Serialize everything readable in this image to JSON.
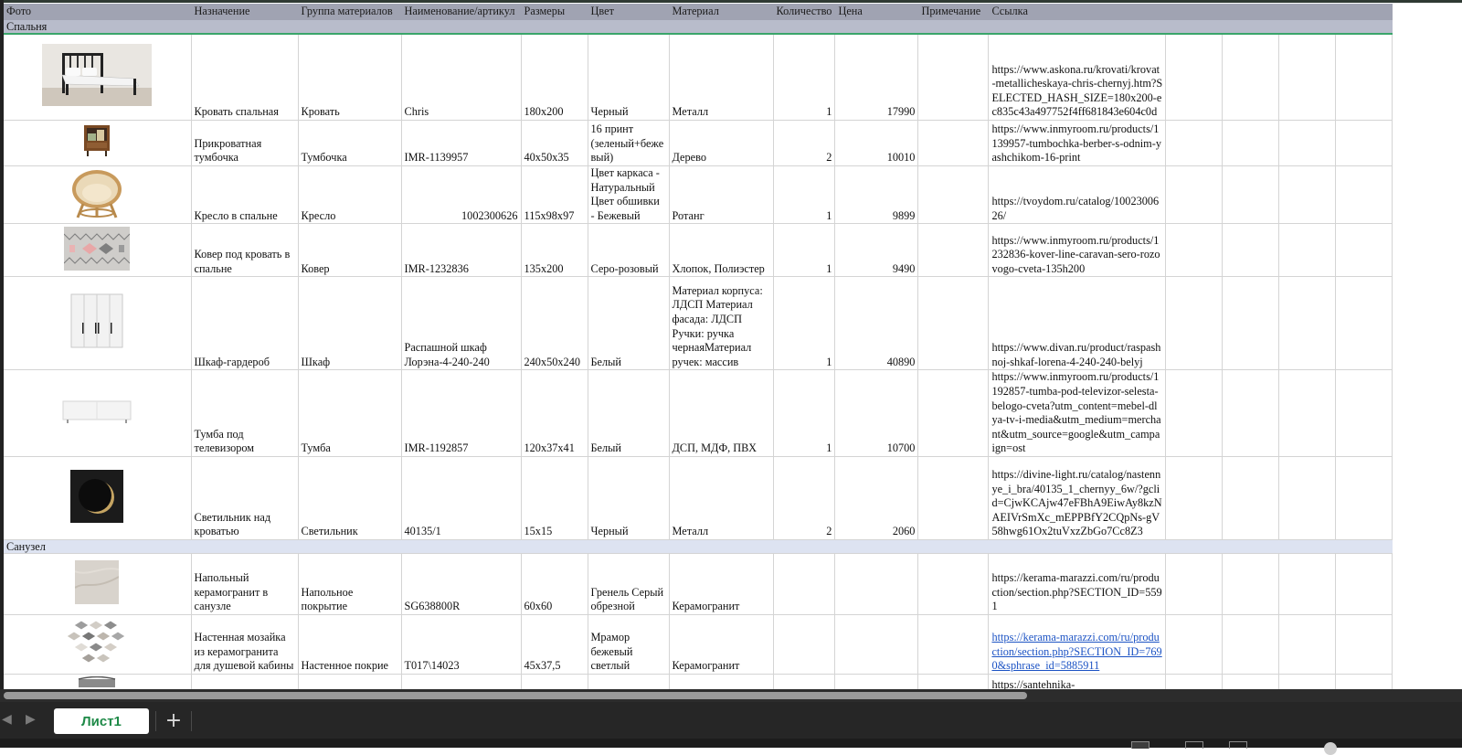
{
  "headers": [
    "Фото",
    "Назначение",
    "Группа материалов",
    "Наименование/артикул",
    "Размеры",
    "Цвет",
    "Материал",
    "Количество",
    "Цена",
    "Примечание",
    "Ссылка",
    "",
    "",
    "",
    ""
  ],
  "sections": [
    {
      "title": "Спальня",
      "rows": [
        {
          "img": "bed-image",
          "purpose": "Кровать спальная",
          "group": "Кровать",
          "name": "Chris",
          "size": "180x200",
          "color": "Черный",
          "material": "Металл",
          "qty": "1",
          "price": "17990",
          "note": "",
          "link": "https://www.askona.ru/krovati/krovat-metallicheskaya-chris-chernyj.htm?SELECTED_HASH_SIZE=180x200-ec835c43a497752f4ff681843e604c0d",
          "link_style": "plain"
        },
        {
          "img": "nightstand-image",
          "purpose": "Прикроватная тумбочка",
          "group": "Тумбочка",
          "name": "IMR-1139957",
          "size": "40x50x35",
          "color": "16 принт (зеленый+бежевый)",
          "material": "Дерево",
          "qty": "2",
          "price": "10010",
          "note": "",
          "link": "https://www.inmyroom.ru/products/1139957-tumbochka-berber-s-odnim-yashchikom-16-print",
          "link_style": "plain"
        },
        {
          "img": "armchair-image",
          "purpose": "Кресло в спальне",
          "group": "Кресло",
          "name": "1002300626",
          "name_align": "right",
          "size": "115x98x97",
          "color": "Цвет каркаса - Натуральный Цвет обшивки - Бежевый",
          "material": "Ротанг",
          "qty": "1",
          "price": "9899",
          "note": "",
          "link": "https://tvoydom.ru/catalog/1002300626/",
          "link_style": "plain"
        },
        {
          "img": "rug-image",
          "purpose": "Ковер под кровать в спальне",
          "group": "Ковер",
          "name": " IMR-1232836",
          "size": "135x200",
          "color": "Серо-розовый",
          "material": "Хлопок, Полиэстер",
          "qty": "1",
          "price": "9490",
          "note": "",
          "link": "https://www.inmyroom.ru/products/1232836-kover-line-caravan-sero-rozovogo-cveta-135h200",
          "link_style": "plain"
        },
        {
          "img": "wardrobe-image",
          "purpose": "Шкаф-гардероб",
          "group": "Шкаф",
          "name": "Распашной шкаф Лорэна-4-240-240",
          "size": "240x50x240",
          "color": "Белый",
          "material": "Материал корпуса: ЛДСП Материал фасада: ЛДСП Ручки: ручка чернаяМатериал ручек: массив",
          "qty": "1",
          "price": "40890",
          "note": "",
          "link": "https://www.divan.ru/product/raspashnoj-shkaf-lorena-4-240-240-belyj",
          "link_style": "plain"
        },
        {
          "img": "tv-stand-image",
          "purpose": "Тумба под телевизором",
          "group": "Тумба",
          "name": " IMR-1192857",
          "size": "120x37x41",
          "color": "Белый",
          "material": "ДСП, МДФ, ПВХ",
          "qty": "1",
          "price": "10700",
          "note": "",
          "link": "https://www.inmyroom.ru/products/1192857-tumba-pod-televizor-selesta-belogo-cveta?utm_content=mebel-dlya-tv-i-media&utm_medium=merchant&utm_source=google&utm_campaign=ost",
          "link_style": "plain"
        },
        {
          "img": "lamp-image",
          "purpose": "Светильник над кроватью",
          "group": "Светильник",
          "name": "40135/1",
          "size": "15x15",
          "color": "Черный",
          "material": "Металл",
          "qty": "2",
          "price": "2060",
          "note": "",
          "link": "https://divine-light.ru/catalog/nastennye_i_bra/40135_1_chernyy_6w/?gclid=CjwKCAjw47eFBhA9EiwAy8kzNAEIVrSmXc_mEPPBfY2CQpNs-gV58hwg61Ox2tuVxzZbGo7Cc8Z3",
          "link_style": "plain"
        }
      ]
    },
    {
      "title": "Санузел",
      "rows": [
        {
          "img": "tile-image",
          "purpose": "Напольный керамогранит в санузле",
          "group": "Напольное покрытие",
          "name": "SG638800R",
          "size": "60x60",
          "color": "Гренель Серый обрезной",
          "material": "Керамогранит",
          "qty": "",
          "price": "",
          "note": "",
          "link": "https://kerama-marazzi.com/ru/production/section.php?SECTION_ID=5591",
          "link_style": "plain"
        },
        {
          "img": "mosaic-image",
          "purpose": "Настенная мозайка из керамогранита для душевой кабины",
          "group": "Настенное покрие",
          "name": "T017\\14023",
          "size": "45x37,5",
          "color": "Мрамор бежевый светлый",
          "material": "Керамогранит",
          "qty": "",
          "price": "",
          "note": "",
          "link": "https://kerama-marazzi.com/ru/production/section.php?SECTION_ID=7690&sphrase_id=5885911",
          "link_style": "hyperlink"
        },
        {
          "img": "fixture-image",
          "purpose": "",
          "group": "",
          "name": "",
          "size": "",
          "color": "",
          "material": "",
          "qty": "",
          "price": "",
          "note": "",
          "link": "https://santehnika-",
          "link_style": "plain"
        }
      ]
    }
  ],
  "sheet_tab": "Лист1",
  "add_sheet_icon": "plus-icon",
  "colors": {
    "header_bg": "#a0a3b2",
    "section1_bg": "#b8bccb",
    "section2_bg": "#dde3f1",
    "accent_green": "#1f8a48",
    "link": "#1c53c4"
  }
}
